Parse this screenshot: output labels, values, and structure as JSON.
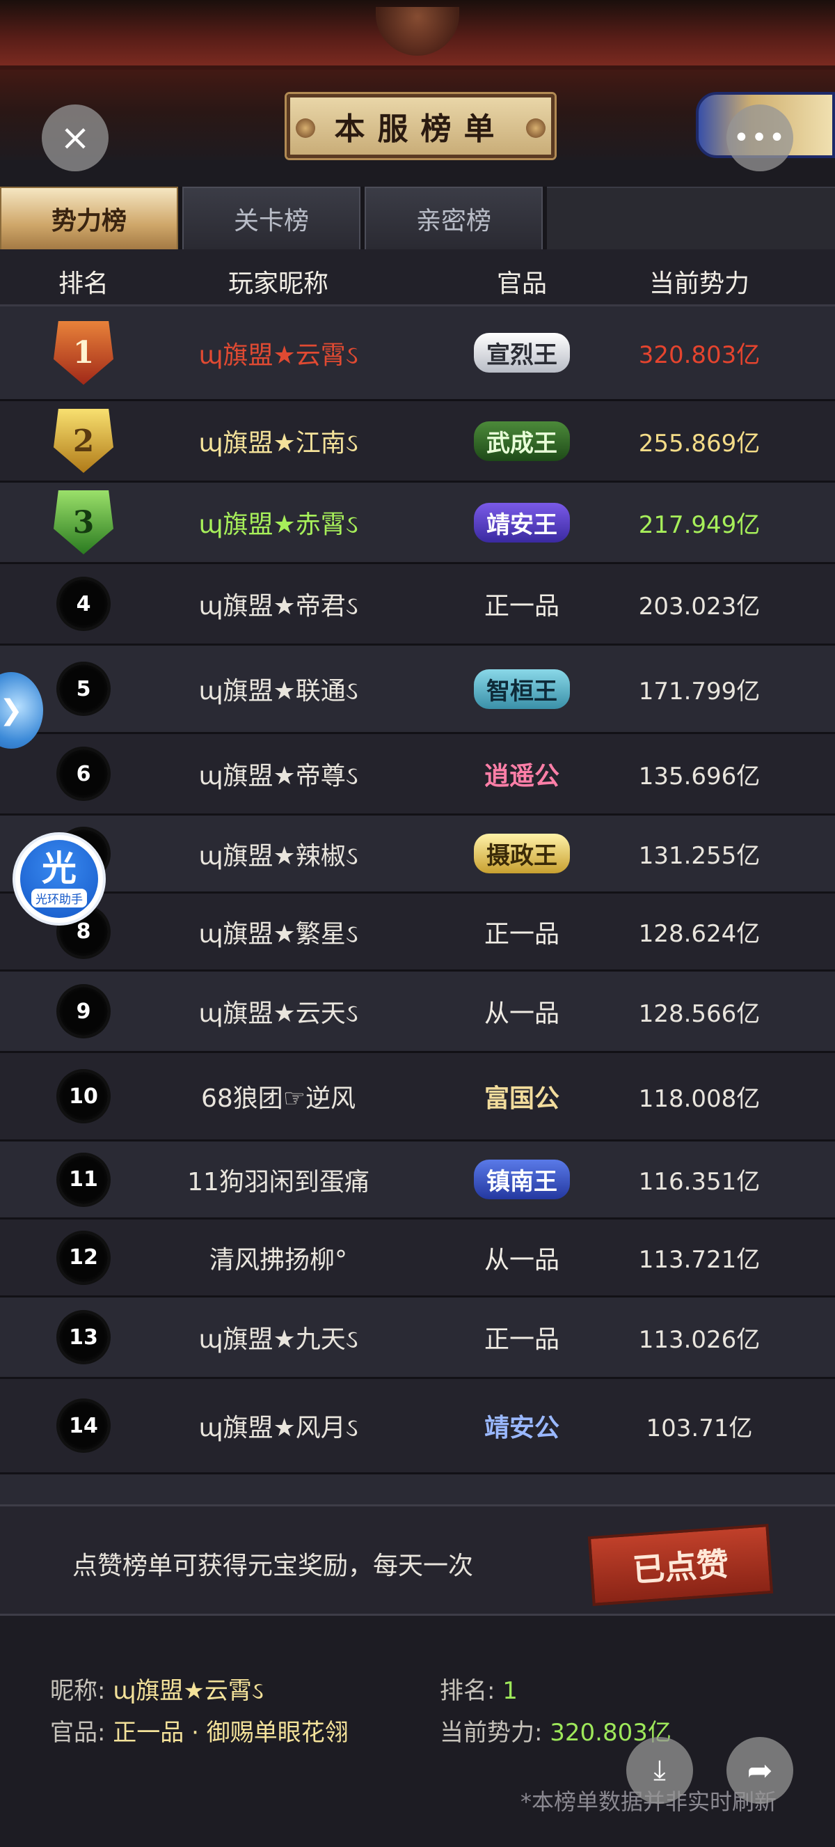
{
  "header": {
    "title": "本服榜单",
    "close_icon": "×",
    "more_icon": "•••"
  },
  "tabs": [
    {
      "label": "势力榜",
      "active": true
    },
    {
      "label": "关卡榜",
      "active": false
    },
    {
      "label": "亲密榜",
      "active": false
    }
  ],
  "columns": {
    "rank": "排名",
    "name": "玩家昵称",
    "title": "官品",
    "power": "当前势力"
  },
  "rows": [
    {
      "rank": "1",
      "name": "ɰ旗盟★云霄ઽ",
      "title": "宣烈王",
      "power": "320.803亿"
    },
    {
      "rank": "2",
      "name": "ɰ旗盟★江南ઽ",
      "title": "武成王",
      "power": "255.869亿"
    },
    {
      "rank": "3",
      "name": "ɰ旗盟★赤霄ઽ",
      "title": "靖安王",
      "power": "217.949亿"
    },
    {
      "rank": "4",
      "name": "ɰ旗盟★帝君ઽ",
      "title": "正一品",
      "power": "203.023亿"
    },
    {
      "rank": "5",
      "name": "ɰ旗盟★联通ઽ",
      "title": "智桓王",
      "power": "171.799亿"
    },
    {
      "rank": "6",
      "name": "ɰ旗盟★帝尊ઽ",
      "title": "逍遥公",
      "power": "135.696亿"
    },
    {
      "rank": "7",
      "name": "ɰ旗盟★辣椒ઽ",
      "title": "摄政王",
      "power": "131.255亿"
    },
    {
      "rank": "8",
      "name": "ɰ旗盟★繁星ઽ",
      "title": "正一品",
      "power": "128.624亿"
    },
    {
      "rank": "9",
      "name": "ɰ旗盟★云天ઽ",
      "title": "从一品",
      "power": "128.566亿"
    },
    {
      "rank": "10",
      "name": "68狼团☞逆风",
      "title": "富国公",
      "power": "118.008亿"
    },
    {
      "rank": "11",
      "name": "11狗羽闲到蛋痛",
      "title": "镇南王",
      "power": "116.351亿"
    },
    {
      "rank": "12",
      "name": "清风拂扬柳°",
      "title": "从一品",
      "power": "113.721亿"
    },
    {
      "rank": "13",
      "name": "ɰ旗盟★九天ઽ",
      "title": "正一品",
      "power": "113.026亿"
    },
    {
      "rank": "14",
      "name": "ɰ旗盟★风月ઽ",
      "title": "靖安公",
      "power": "103.71亿"
    }
  ],
  "reward": {
    "text": "点赞榜单可获得元宝奖励，每天一次",
    "liked_label": "已点赞"
  },
  "my_info": {
    "nickname_label": "昵称:",
    "nickname": "ɰ旗盟★云霄ઽ",
    "rank_label": "排名:",
    "rank": "1",
    "title_label": "官品:",
    "title": "正一品 · 御赐单眼花翎",
    "power_label": "当前势力:",
    "power": "320.803亿"
  },
  "footnote": "*本榜单数据并非实时刷新",
  "overlays": {
    "helper_glyph": "光",
    "helper_label": "光环助手",
    "download_icon": "⤓",
    "share_icon": "➦"
  },
  "colors": {
    "rank1": "#e04a32",
    "rank2": "#f4e29a",
    "rank3": "#a7ef5a"
  }
}
